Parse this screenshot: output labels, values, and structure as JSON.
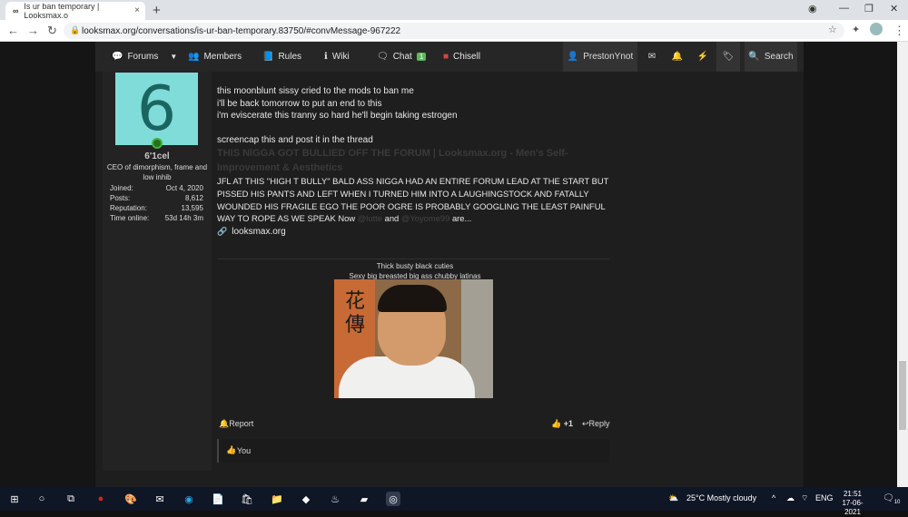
{
  "browser": {
    "tab_title": "Is ur ban temporary | Looksmax.o",
    "url": "looksmax.org/conversations/is-ur-ban-temporary.83750/#convMessage-967222",
    "new_tab": "+",
    "close_tab": "×"
  },
  "nav": {
    "forums": "Forums",
    "members": "Members",
    "rules": "Rules",
    "wiki": "Wiki",
    "chat": "Chat",
    "chat_badge": "1",
    "chisell": "Chisell",
    "user": "PrestonYnot",
    "search": "Search"
  },
  "post": {
    "avatar_letter": "6",
    "username": "6'1cel",
    "user_title": "CEO of dimorphism, frame and low inhib",
    "stats": [
      {
        "label": "Joined:",
        "value": "Oct 4, 2020"
      },
      {
        "label": "Posts:",
        "value": "8,612"
      },
      {
        "label": "Reputation:",
        "value": "13,595"
      },
      {
        "label": "Time online:",
        "value": "53d 14h 3m"
      }
    ],
    "lines": [
      "this moonblunt sissy cried to the mods to ban me",
      "i'll be back tomorrow to put an end to this",
      "i'm eviscerate this tranny so hard he'll begin taking estrogen"
    ],
    "screencap": "screencap this and post it in the thread",
    "quote_title": "THIS NIGGA GOT BULLIED OFF THE FORUM | Looksmax.org - Men's Self-Improvement & Aesthetics",
    "shout": "JFL AT THIS \"HIGH T BULLY\" BALD ASS NIGGA HAD AN ENTIRE FORUM LEAD AT THE START BUT PISSED HIS PANTS AND LEFT WHEN I TURNED HIM INTO A LAUGHINGSTOCK AND FATALLY WOUNDED HIS FRAGILE EGO THE POOR OGRE IS PROBABLY GOOGLING THE LEAST PAINFUL WAY TO ROPE AS WE SPEAK Now",
    "mention1": "@lutte",
    "and": "and",
    "mention2": "@Yoyome99",
    "are": "are...",
    "link": "looksmax.org",
    "caption1": "Thick busty black cuties",
    "caption2": "Sexy big breasted big ass chubby latinas",
    "report": "Report",
    "plus_one": "+1",
    "reply": "Reply",
    "reaction_you": "You"
  },
  "taskbar": {
    "weather": "25°C  Mostly cloudy",
    "lang": "ENG",
    "time": "21:51",
    "date": "17-06-2021",
    "notif_count": "10"
  }
}
